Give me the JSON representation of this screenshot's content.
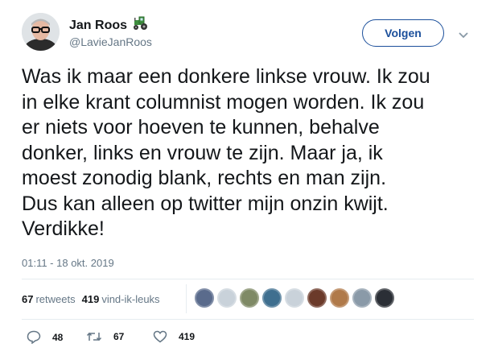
{
  "author": {
    "display_name": "Jan Roos",
    "name_emoji_icon": "tractor-icon",
    "handle": "@LavieJanRoos",
    "avatar_icon": "profile-photo"
  },
  "follow_button": {
    "label": "Volgen"
  },
  "tweet": {
    "text": "Was ik maar een donkere linkse vrouw. Ik zou\nin elke krant columnist mogen worden. Ik zou\ner niets voor hoeven te kunnen, behalve\ndonker, links en vrouw te zijn. Maar ja, ik\nmoest zonodig blank, rechts en man zijn.\nDus kan alleen op twitter mijn onzin kwijt.\nVerdikke!",
    "timestamp": "01:11 - 18 okt. 2019"
  },
  "stats": {
    "retweets_count": "67",
    "retweets_label": "retweets",
    "likes_count": "419",
    "likes_label": "vind-ik-leuks"
  },
  "liker_avatars": [
    "#5a6b8c",
    "#c9d2da",
    "#7f8a66",
    "#3f6f8f",
    "#c9d2da",
    "#6b3a2a",
    "#b07a4a",
    "#8a9aa8",
    "#2b2f36"
  ],
  "actions": {
    "reply_count": "48",
    "retweet_count": "67",
    "like_count": "419"
  },
  "colors": {
    "accent": "#1b4f9b",
    "secondary_text": "#657786",
    "text": "#14171a"
  }
}
